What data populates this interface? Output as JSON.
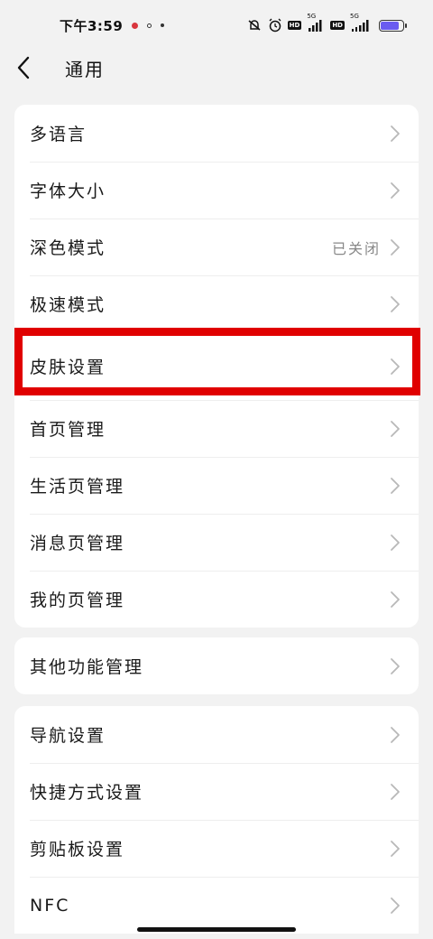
{
  "status_bar": {
    "time": "下午3:59",
    "network_1": "5G",
    "network_2": "5G",
    "hd_1": "HD",
    "hd_2": "HD",
    "battery_level": 0.85,
    "battery_color": "#6a5cf0"
  },
  "header": {
    "title": "通用",
    "back_icon": "chevron-left-icon"
  },
  "groups": [
    {
      "items": [
        {
          "label": "多语言",
          "value": ""
        },
        {
          "label": "字体大小",
          "value": ""
        },
        {
          "label": "深色模式",
          "value": "已关闭"
        },
        {
          "label": "极速模式",
          "value": ""
        },
        {
          "label": "皮肤设置",
          "value": ""
        },
        {
          "label": "首页管理",
          "value": ""
        },
        {
          "label": "生活页管理",
          "value": ""
        },
        {
          "label": "消息页管理",
          "value": ""
        },
        {
          "label": "我的页管理",
          "value": ""
        }
      ]
    },
    {
      "items": [
        {
          "label": "其他功能管理",
          "value": ""
        }
      ]
    },
    {
      "items": [
        {
          "label": "导航设置",
          "value": ""
        },
        {
          "label": "快捷方式设置",
          "value": ""
        },
        {
          "label": "剪贴板设置",
          "value": ""
        },
        {
          "label": "NFC",
          "value": ""
        }
      ]
    }
  ],
  "highlight_color": "#e00000"
}
